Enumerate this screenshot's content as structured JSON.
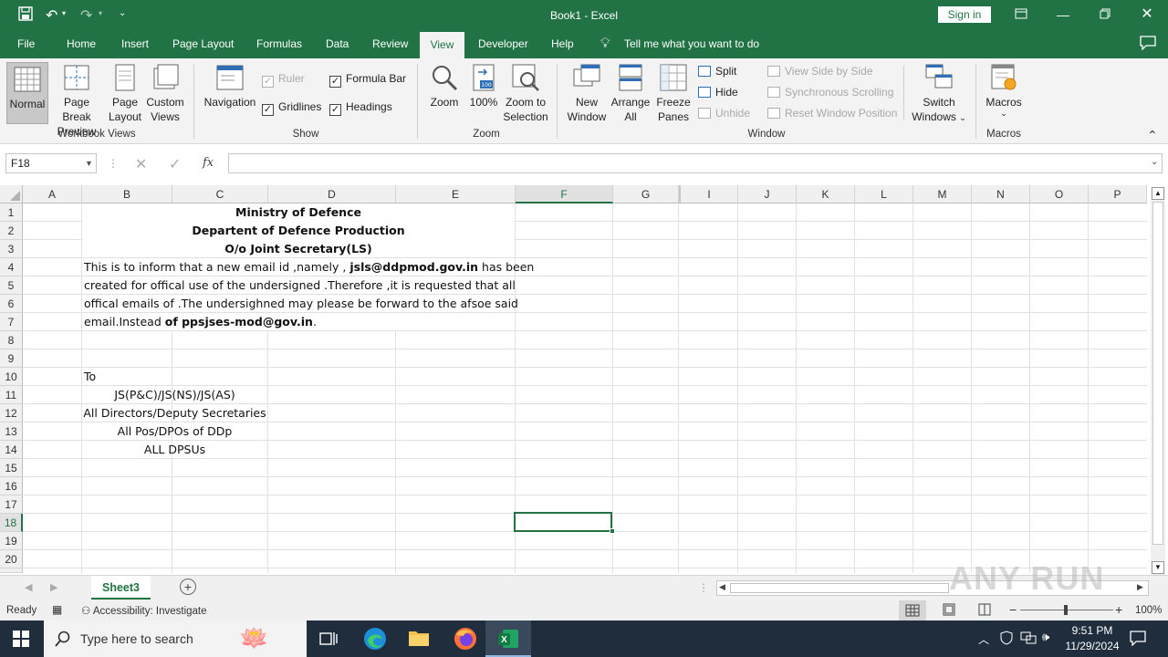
{
  "window": {
    "title": "Book1  -  Excel",
    "sign_in": "Sign in"
  },
  "tabs": [
    "File",
    "Home",
    "Insert",
    "Page Layout",
    "Formulas",
    "Data",
    "Review",
    "View",
    "Developer",
    "Help"
  ],
  "tell_me": "Tell me what you want to do",
  "ribbon": {
    "workbook_views": {
      "group": "Workbook Views",
      "normal": "Normal",
      "page_break_1": "Page Break",
      "page_break_2": "Preview",
      "page_layout_1": "Page",
      "page_layout_2": "Layout",
      "custom_views_1": "Custom",
      "custom_views_2": "Views"
    },
    "show": {
      "group": "Show",
      "navigation": "Navigation",
      "ruler": "Ruler",
      "formula_bar": "Formula Bar",
      "gridlines": "Gridlines",
      "headings": "Headings"
    },
    "zoom": {
      "group": "Zoom",
      "zoom": "Zoom",
      "hundred": "100%",
      "zoom_sel_1": "Zoom to",
      "zoom_sel_2": "Selection"
    },
    "window": {
      "group": "Window",
      "new_window_1": "New",
      "new_window_2": "Window",
      "arrange_1": "Arrange",
      "arrange_2": "All",
      "freeze_1": "Freeze",
      "freeze_2": "Panes",
      "split": "Split",
      "hide": "Hide",
      "unhide": "Unhide",
      "side_by_side": "View Side by Side",
      "sync_scroll": "Synchronous Scrolling",
      "reset_pos": "Reset Window Position",
      "switch_1": "Switch",
      "switch_2": "Windows"
    },
    "macros": {
      "group": "Macros",
      "macros": "Macros"
    }
  },
  "formula_bar": {
    "name_box": "F18",
    "fx": "fx",
    "content": ""
  },
  "columns": [
    "A",
    "B",
    "C",
    "D",
    "E",
    "F",
    "G",
    "I",
    "J",
    "K",
    "L",
    "M",
    "N",
    "O",
    "P"
  ],
  "rows": [
    "1",
    "2",
    "3",
    "4",
    "5",
    "6",
    "7",
    "8",
    "9",
    "10",
    "11",
    "12",
    "13",
    "14",
    "15",
    "16",
    "17",
    "18",
    "19",
    "20"
  ],
  "cells": {
    "r1": "Ministry of Defence",
    "r2": "Departent of Defence Production",
    "r3": "O/o Joint Secretary(LS)",
    "r4_a": "This is to inform that a new email id ,namely , ",
    "r4_b": "jsls@ddpmod.gov.in",
    "r4_c": " has been",
    "r5": "created for offical use of the undersigned .Therefore ,it is requested that all",
    "r6": "offical emails of .The undersighned may please be forward to the afsoe said",
    "r7_a": "email.Instead ",
    "r7_b": "of ppsjses-mod@gov.in",
    "r7_c": ".",
    "r10": "To",
    "r11": "JS(P&C)/JS(NS)/JS(AS)",
    "r12": "All Directors/Deputy Secretaries",
    "r13": "All Pos/DPOs of DDp",
    "r14": "ALL DPSUs"
  },
  "sheet_tab": "Sheet3",
  "status": {
    "ready": "Ready",
    "accessibility": "Accessibility: Investigate",
    "zoom": "100%"
  },
  "taskbar": {
    "search_placeholder": "Type here to search",
    "time": "9:51 PM",
    "date": "11/29/2024"
  },
  "watermark": "ANY RUN"
}
